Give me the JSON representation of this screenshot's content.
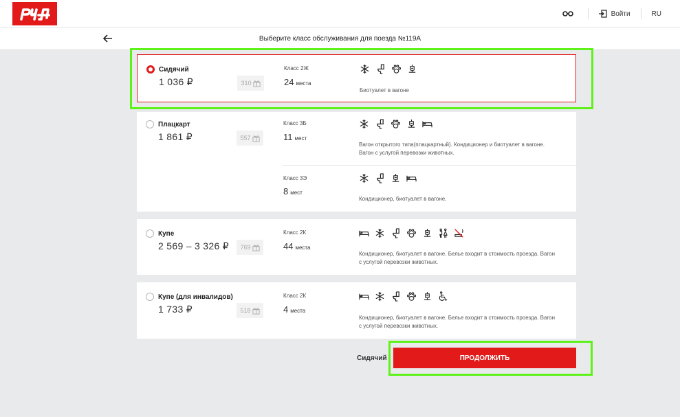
{
  "header": {
    "logo_text": "РЖД",
    "login_label": "Войти",
    "lang_label": "RU",
    "accessibility_icon": "glasses-icon",
    "login_icon": "login-icon"
  },
  "subheader": {
    "title": "Выберите класс обслуживания для поезда №119А",
    "back_icon": "arrow-left-icon"
  },
  "cards": [
    {
      "name": "Сидячий",
      "price": "1 036 ₽",
      "bonus": "310",
      "selected": true,
      "classes": [
        {
          "label": "Класс 2Ж",
          "seats_count": "24",
          "seats_word": "места",
          "icons": [
            "snowflake-icon",
            "toilet-icon",
            "paw-icon",
            "bio-icon"
          ],
          "desc": "Биотуалет в вагоне"
        }
      ]
    },
    {
      "name": "Плацкарт",
      "price": "1 861 ₽",
      "bonus": "557",
      "selected": false,
      "classes": [
        {
          "label": "Класс 3Б",
          "seats_count": "11",
          "seats_word": "мест",
          "icons": [
            "snowflake-icon",
            "toilet-icon",
            "paw-icon",
            "bio-icon",
            "bed-icon"
          ],
          "desc": "Вагон открытого типа(плацкартный). Кондиционер и биотуалет в вагоне. Вагон с услугой перевозки животных."
        },
        {
          "label": "Класс 3Э",
          "seats_count": "8",
          "seats_word": "мест",
          "icons": [
            "snowflake-icon",
            "toilet-icon",
            "bio-icon",
            "bed-icon"
          ],
          "desc": "Кондиционер, биотуалет в вагоне."
        }
      ]
    },
    {
      "name": "Купе",
      "price": "2 569 – 3 326 ₽",
      "bonus": "769",
      "selected": false,
      "classes": [
        {
          "label": "Класс 2К",
          "seats_count": "44",
          "seats_word": "места",
          "icons": [
            "bed-icon",
            "snowflake-icon",
            "toilet-icon",
            "paw-icon",
            "bio-icon",
            "mixed-gender-icon",
            "no-smoking-icon"
          ],
          "desc": "Кондиционер, биотуалет в вагоне. Белье входит в стоимость проезда. Вагон с услугой перевозки животных."
        }
      ]
    },
    {
      "name": "Купе (для инвалидов)",
      "price": "1 733 ₽",
      "bonus": "518",
      "selected": false,
      "classes": [
        {
          "label": "Класс 2К",
          "seats_count": "4",
          "seats_word": "места",
          "icons": [
            "bed-icon",
            "snowflake-icon",
            "toilet-icon",
            "paw-icon",
            "bio-icon",
            "wheelchair-icon"
          ],
          "desc": "Кондиционер, биотуалет в вагоне. Белье входит в стоимость проезда. Вагон с услугой перевозки животных."
        }
      ]
    }
  ],
  "footer": {
    "selected_summary": "Сидячий",
    "continue_label": "ПРОДОЛЖИТЬ"
  },
  "colors": {
    "brand": "#e21a1a",
    "highlight": "#5ef21a",
    "background": "#e9eaec"
  }
}
